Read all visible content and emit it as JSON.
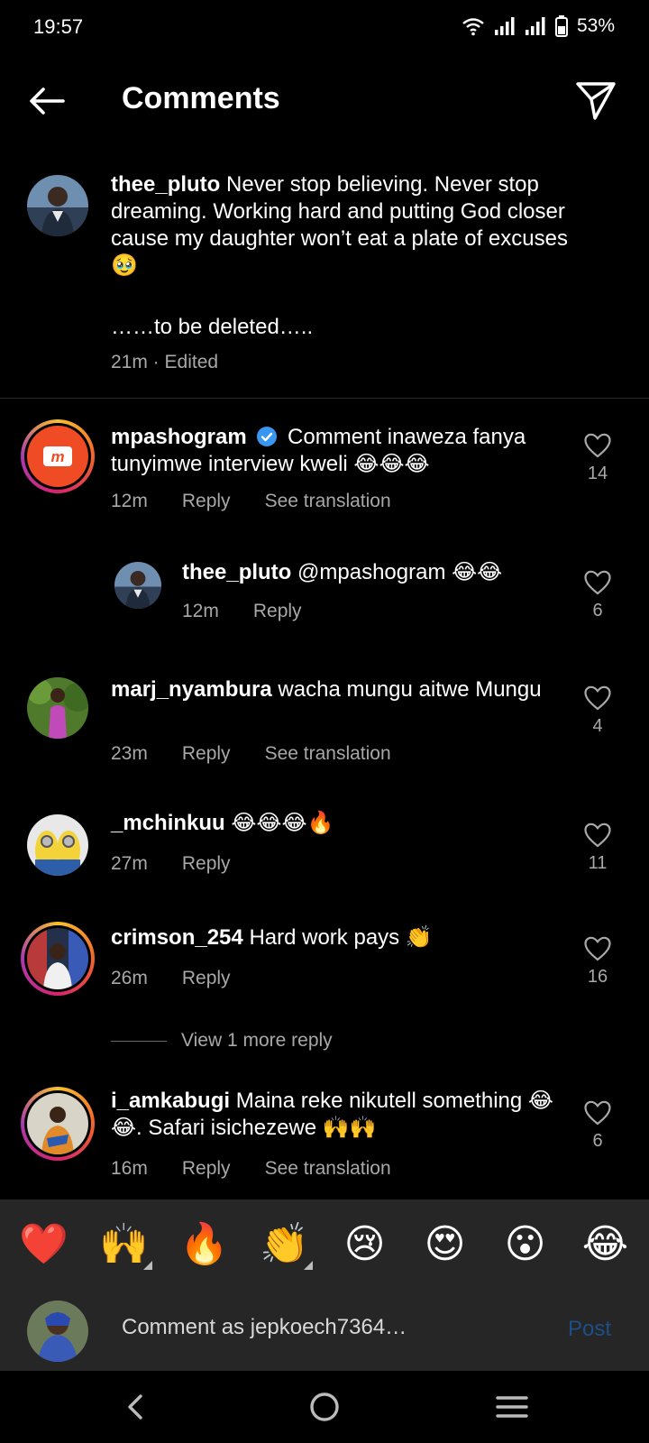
{
  "status": {
    "time": "19:57",
    "battery": "53%"
  },
  "header": {
    "title": "Comments"
  },
  "caption": {
    "username": "thee_pluto",
    "text": "Never stop believing. Never stop dreaming. Working hard and putting God closer cause my daughter won’t eat a plate of excuses 🥹",
    "text2": "……to be deleted…..",
    "meta": "21m · Edited"
  },
  "comments": [
    {
      "username": "mpashogram",
      "verified": true,
      "text": "Comment inaweza fanya tunyimwe interview kweli 😂😂😂",
      "time": "12m",
      "reply": "Reply",
      "translate": "See translation",
      "likes": "14"
    },
    {
      "username": "thee_pluto",
      "text": "@mpashogram 😂😂",
      "time": "12m",
      "reply": "Reply",
      "likes": "6"
    },
    {
      "username": "marj_nyambura",
      "text": "wacha mungu aitwe Mungu",
      "time": "23m",
      "reply": "Reply",
      "translate": "See translation",
      "likes": "4"
    },
    {
      "username": "_mchinkuu",
      "text": "😂😂😂🔥",
      "time": "27m",
      "reply": "Reply",
      "likes": "11"
    },
    {
      "username": "crimson_254",
      "text": "Hard work pays 👏",
      "time": "26m",
      "reply": "Reply",
      "likes": "16"
    },
    {
      "username": "i_amkabugi",
      "text": "Maina reke nikutell something 😂😂. Safari isichezewe 🙌🙌",
      "time": "16m",
      "reply": "Reply",
      "translate": "See translation",
      "likes": "6"
    }
  ],
  "view_more": "View 1 more reply",
  "emojis": [
    "❤️",
    "🙌",
    "🔥",
    "👏",
    "😢",
    "😍",
    "😮",
    "😂"
  ],
  "input": {
    "placeholder": "Comment as jepkoech7364…",
    "post_label": "Post"
  },
  "colors": {
    "accent_blue": "#0095f6",
    "post_disabled": "#1d4f86",
    "verified": "#3897f0",
    "mpasho_orange": "#ef4b24"
  }
}
